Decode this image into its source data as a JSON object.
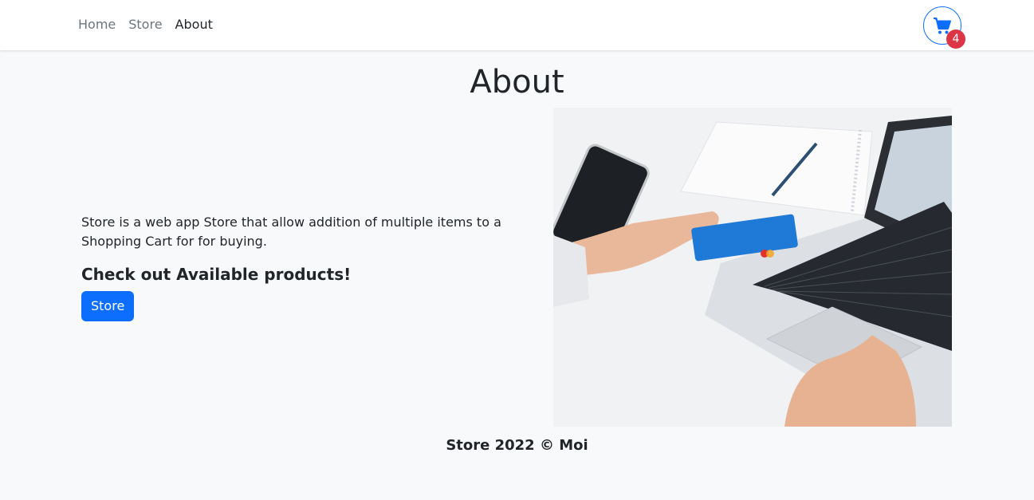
{
  "nav": {
    "links": [
      {
        "label": "Home",
        "active": false
      },
      {
        "label": "Store",
        "active": false
      },
      {
        "label": "About",
        "active": true
      }
    ],
    "cart": {
      "icon": "shopping-cart-icon",
      "count": "4",
      "accent": "#0d6efd",
      "badge_color": "#dc3545"
    }
  },
  "page": {
    "title": "About",
    "intro": "Store is a web app Store that allow addition of multiple items to a Shopping Cart for for buying.",
    "subheading": "Check out Available products!",
    "store_button": "Store",
    "image": "laptop-credit-card-photo"
  },
  "footer": {
    "text": "Store 2022 © Moi"
  },
  "colors": {
    "background": "#f8f9fa",
    "primary": "#0d6efd"
  }
}
